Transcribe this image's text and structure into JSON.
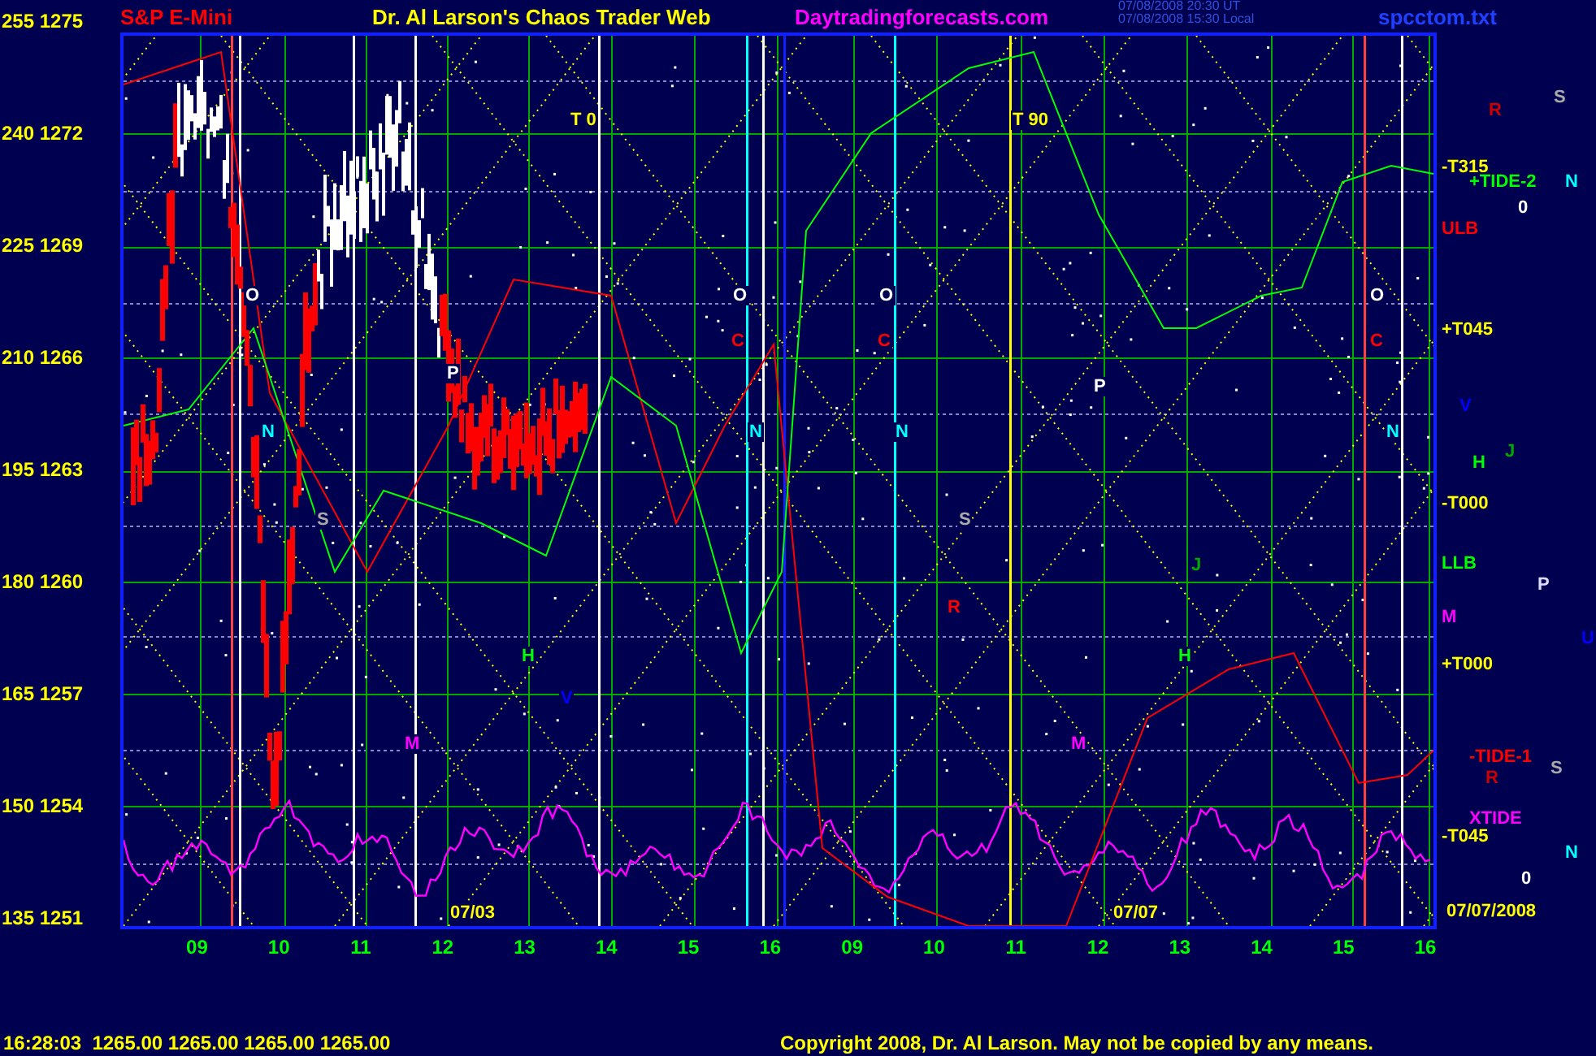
{
  "header": {
    "symbol": "S&P E-Mini",
    "title": "Dr. Al Larson's Chaos Trader Web",
    "site": "Daytradingforecasts.com",
    "times": [
      "07/08/2008 20:30 UT",
      "07/08/2008 15:30 Local"
    ],
    "file": "spcctom.txt"
  },
  "y_axis": [
    "255 1275",
    "240 1272",
    "225 1269",
    "210 1266",
    "195 1263",
    "180 1260",
    "165 1257",
    "150 1254",
    "135 1251"
  ],
  "x_axis": [
    "09",
    "10",
    "11",
    "12",
    "13",
    "14",
    "15",
    "16",
    "09",
    "10",
    "11",
    "12",
    "13",
    "14",
    "15",
    "16"
  ],
  "chart_labels": [
    {
      "text": "T 0",
      "color": "#ffff00"
    },
    {
      "text": "T 90",
      "color": "#ffff00"
    },
    {
      "text": "O",
      "color": "#ffffff"
    },
    {
      "text": "O",
      "color": "#ffffff"
    },
    {
      "text": "O",
      "color": "#ffffff"
    },
    {
      "text": "O",
      "color": "#ffffff"
    },
    {
      "text": "C",
      "color": "#ff0000"
    },
    {
      "text": "C",
      "color": "#ff0000"
    },
    {
      "text": "C",
      "color": "#ff0000"
    },
    {
      "text": "N",
      "color": "#00ffff"
    },
    {
      "text": "N",
      "color": "#00ffff"
    },
    {
      "text": "N",
      "color": "#00ffff"
    },
    {
      "text": "N",
      "color": "#00ffff"
    },
    {
      "text": "P",
      "color": "#ffffff"
    },
    {
      "text": "P",
      "color": "#ffffff"
    },
    {
      "text": "S",
      "color": "#aaaaaa"
    },
    {
      "text": "S",
      "color": "#aaaaaa"
    },
    {
      "text": "J",
      "color": "#00aa00"
    },
    {
      "text": "H",
      "color": "#00ff00"
    },
    {
      "text": "H",
      "color": "#00ff00"
    },
    {
      "text": "V",
      "color": "#0000ff"
    },
    {
      "text": "M",
      "color": "#ff00ff"
    },
    {
      "text": "M",
      "color": "#ff00ff"
    },
    {
      "text": "R",
      "color": "#ff0000"
    },
    {
      "text": "07/03",
      "color": "#ffff00"
    },
    {
      "text": "07/07",
      "color": "#ffff00"
    }
  ],
  "side_labels": [
    {
      "text": "R",
      "color": "#cc0000"
    },
    {
      "text": "S",
      "color": "#aaaaaa"
    },
    {
      "text": "-T315",
      "color": "#ffff00"
    },
    {
      "text": "+TIDE-2",
      "color": "#00ff00"
    },
    {
      "text": "N",
      "color": "#00ffff"
    },
    {
      "text": "0",
      "color": "#ffffff"
    },
    {
      "text": "ULB",
      "color": "#ff0000"
    },
    {
      "text": "+T045",
      "color": "#ffff00"
    },
    {
      "text": "V",
      "color": "#0000ff"
    },
    {
      "text": "J",
      "color": "#00aa00"
    },
    {
      "text": "H",
      "color": "#00ff00"
    },
    {
      "text": "-T000",
      "color": "#ffff00"
    },
    {
      "text": "LLB",
      "color": "#00ff00"
    },
    {
      "text": "P",
      "color": "#ddddff"
    },
    {
      "text": "M",
      "color": "#ff00ff"
    },
    {
      "text": "U",
      "color": "#0000ff"
    },
    {
      "text": "+T000",
      "color": "#ffff00"
    },
    {
      "text": "-TIDE-1",
      "color": "#ff0000"
    },
    {
      "text": "S",
      "color": "#aaaaaa"
    },
    {
      "text": "R",
      "color": "#cc0000"
    },
    {
      "text": "XTIDE",
      "color": "#ff00ff"
    },
    {
      "text": "-T045",
      "color": "#ffff00"
    },
    {
      "text": "N",
      "color": "#00ffff"
    },
    {
      "text": "0",
      "color": "#ffffff"
    },
    {
      "text": "07/07/2008",
      "color": "#ffff00"
    }
  ],
  "footer": {
    "quote": "16:28:03  1265.00 1265.00 1265.00 1265.00",
    "copyright": "Copyright 2008, Dr. Al Larson. May not be copied by any means."
  }
}
